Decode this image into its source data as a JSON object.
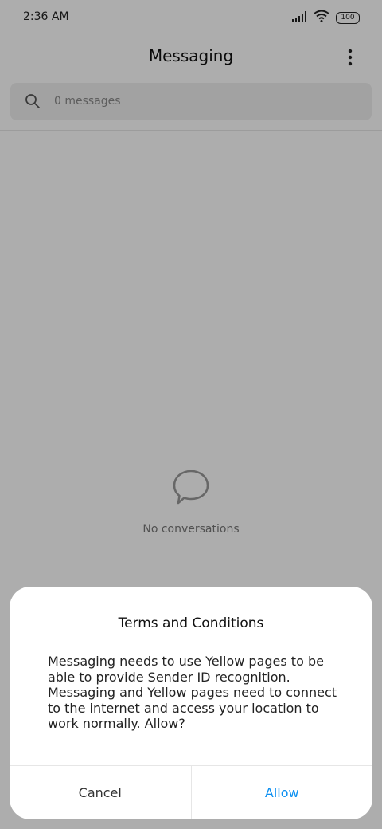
{
  "status_bar": {
    "time": "2:36 AM",
    "battery": "100"
  },
  "app_bar": {
    "title": "Messaging"
  },
  "search": {
    "placeholder": "0 messages"
  },
  "empty_state": {
    "text": "No conversations"
  },
  "dialog": {
    "title": "Terms and Conditions",
    "message": "Messaging needs to use Yellow pages to be able to provide Sender ID recognition. Messaging and Yellow pages need to connect to the internet and access your location to work normally. Allow?",
    "cancel_label": "Cancel",
    "allow_label": "Allow"
  },
  "colors": {
    "accent": "#0b8ff1"
  }
}
